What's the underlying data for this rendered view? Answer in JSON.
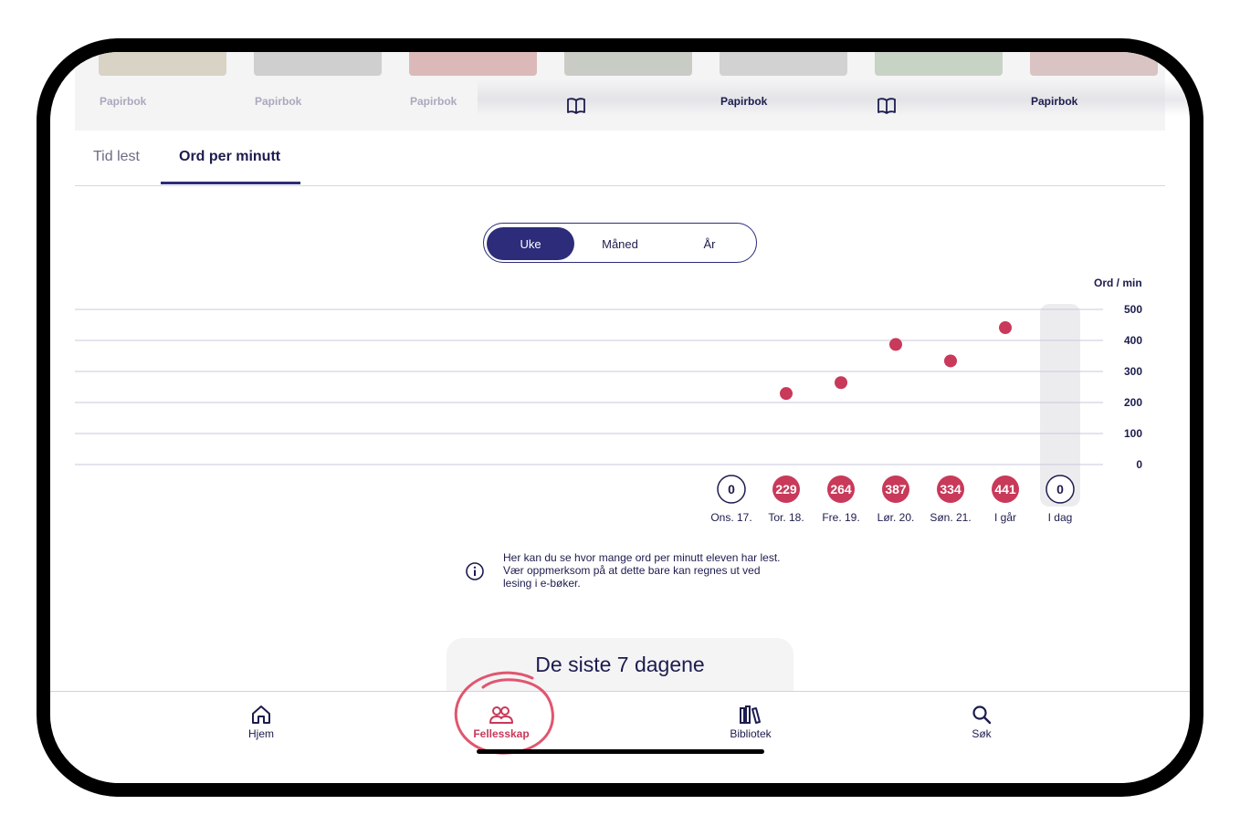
{
  "books": {
    "labels": [
      "Papirbok",
      "Papirbok",
      "Papirbok",
      "Papirbok",
      "Papirbok"
    ],
    "icons": [
      "open-book-icon",
      "open-book-icon"
    ]
  },
  "tabs": [
    {
      "label": "Tid lest",
      "active": false
    },
    {
      "label": "Ord per minutt",
      "active": true
    }
  ],
  "period_toggle": {
    "options": [
      "Uke",
      "Måned",
      "År"
    ],
    "selected": "Uke"
  },
  "chart_data": {
    "type": "scatter",
    "ylabel": "Ord / min",
    "ylim": [
      0,
      500
    ],
    "yticks": [
      "0",
      "100",
      "200",
      "300",
      "400",
      "500"
    ],
    "categories": [
      "Ons. 17.",
      "Tor. 18.",
      "Fre. 19.",
      "Lør. 20.",
      "Søn. 21.",
      "I går",
      "I dag"
    ],
    "values": [
      0,
      229,
      264,
      387,
      334,
      441,
      0
    ],
    "value_labels": [
      "0",
      "229",
      "264",
      "387",
      "334",
      "441",
      "0"
    ],
    "highlighted_category": "I dag",
    "colors": {
      "point": "#c8395a",
      "axis_text": "#1c1c4e",
      "grid": "#c9c9dc",
      "highlight": "#ececef"
    }
  },
  "info": {
    "icon": "info-icon",
    "text_lines": [
      "Her kan du se hvor mange ord per minutt eleven har lest.",
      "Vær oppmerksom på at dette bare kan regnes ut ved",
      "lesing i e-bøker."
    ]
  },
  "summary_card": {
    "title": "De siste 7 dagene"
  },
  "bottom_nav": {
    "items": [
      {
        "label": "Hjem",
        "icon": "home-icon"
      },
      {
        "label": "Fellesskap",
        "icon": "community-icon",
        "active": true
      },
      {
        "label": "Bibliotek",
        "icon": "library-icon"
      },
      {
        "label": "Søk",
        "icon": "search-icon"
      }
    ]
  },
  "colors": {
    "accent": "#2c2c7a",
    "highlight": "#c8395a"
  }
}
